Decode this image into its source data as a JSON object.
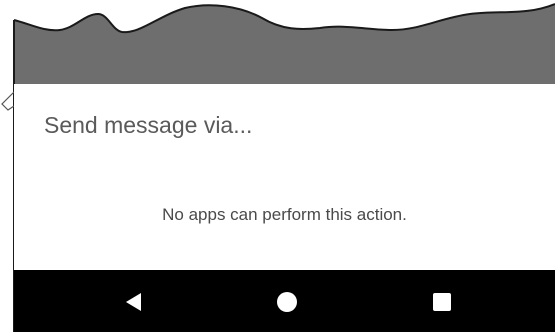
{
  "dialog": {
    "title": "Send message via...",
    "empty_message": "No apps can perform this action."
  },
  "navigation_bar": {
    "buttons": [
      {
        "name": "back",
        "icon": "back-triangle-icon"
      },
      {
        "name": "home",
        "icon": "home-circle-icon"
      },
      {
        "name": "recents",
        "icon": "recents-square-icon"
      }
    ]
  },
  "colors": {
    "scrim": "#6e6e6e",
    "dialog_background": "#ffffff",
    "navigation_bar": "#000000",
    "title_text": "#5a5a5a",
    "body_text": "#4a4a4a",
    "nav_icon": "#ffffff"
  }
}
